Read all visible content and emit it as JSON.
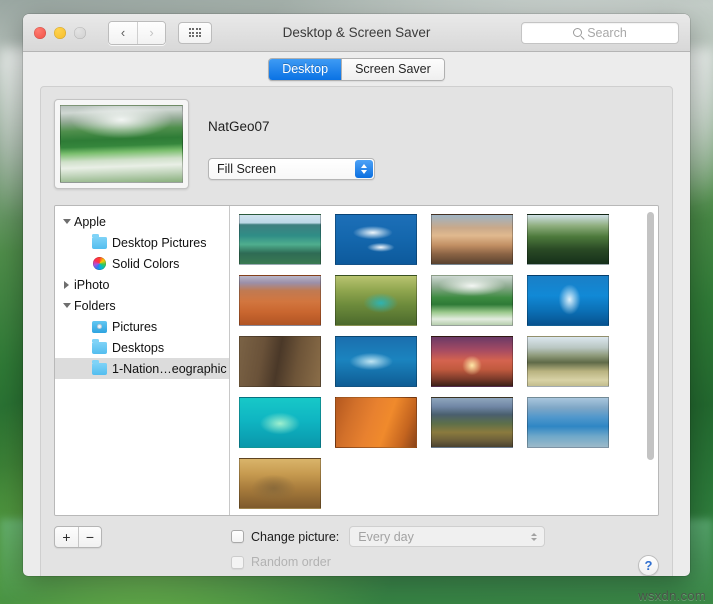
{
  "desktop": {
    "watermark": "wsxdn.com"
  },
  "window": {
    "title": "Desktop & Screen Saver",
    "traffic": {
      "close": "close-button",
      "minimize": "minimize-button",
      "zoom": "zoom-button"
    },
    "nav": {
      "back": "‹",
      "forward": "›"
    },
    "search": {
      "placeholder": "Search"
    }
  },
  "tabs": [
    {
      "label": "Desktop",
      "active": true
    },
    {
      "label": "Screen Saver",
      "active": false
    }
  ],
  "preview": {
    "picture_name": "NatGeo07",
    "scale_mode": "Fill Screen"
  },
  "sourcelist": {
    "items": [
      {
        "label": "Apple",
        "level": 0,
        "disclosure": "open",
        "icon": "none",
        "selected": false
      },
      {
        "label": "Desktop Pictures",
        "level": 1,
        "disclosure": "none",
        "icon": "folder",
        "selected": false
      },
      {
        "label": "Solid Colors",
        "level": 1,
        "disclosure": "none",
        "icon": "color",
        "selected": false
      },
      {
        "label": "iPhoto",
        "level": 0,
        "disclosure": "closed",
        "icon": "none",
        "selected": false
      },
      {
        "label": "Folders",
        "level": 0,
        "disclosure": "open",
        "icon": "none",
        "selected": false
      },
      {
        "label": "Pictures",
        "level": 1,
        "disclosure": "none",
        "icon": "photos",
        "selected": false
      },
      {
        "label": "Desktops",
        "level": 1,
        "disclosure": "none",
        "icon": "folder",
        "selected": false
      },
      {
        "label": "1-Nation…eographic",
        "level": 1,
        "disclosure": "none",
        "icon": "folder",
        "selected": true
      }
    ]
  },
  "thumbnails": [
    {
      "name": "penguins-on-ice-split-water"
    },
    {
      "name": "polar-bear-underwater"
    },
    {
      "name": "snow-mountain-peak-sunset"
    },
    {
      "name": "green-hills-dark-foreground"
    },
    {
      "name": "flamingos-orange-lake"
    },
    {
      "name": "bee-eater-birds-pair"
    },
    {
      "name": "misty-green-valley-lake"
    },
    {
      "name": "blue-ice-glacier-cave"
    },
    {
      "name": "leopard-in-tree"
    },
    {
      "name": "whale-shark-underwater"
    },
    {
      "name": "acacia-tree-sunset-savanna"
    },
    {
      "name": "hills-reflected-in-marsh"
    },
    {
      "name": "turquoise-parrotfish"
    },
    {
      "name": "orange-sand-dune"
    },
    {
      "name": "autumn-lake-mountains"
    },
    {
      "name": "blue-iceberg-on-shore"
    },
    {
      "name": "lion-in-golden-grass"
    }
  ],
  "bottom": {
    "add_label": "+",
    "remove_label": "−",
    "change_picture_label": "Change picture:",
    "change_picture_checked": false,
    "interval_value": "Every day",
    "interval_enabled": false,
    "random_order_label": "Random order",
    "random_order_checked": false,
    "random_order_enabled": false,
    "help_label": "?"
  },
  "colors": {
    "accent_blue": "#0a72e4",
    "window_bg": "#ececec",
    "panel_bg": "#e3e3e3",
    "selected_row": "#dcdcdc",
    "help_blue": "#2f6fd0"
  }
}
